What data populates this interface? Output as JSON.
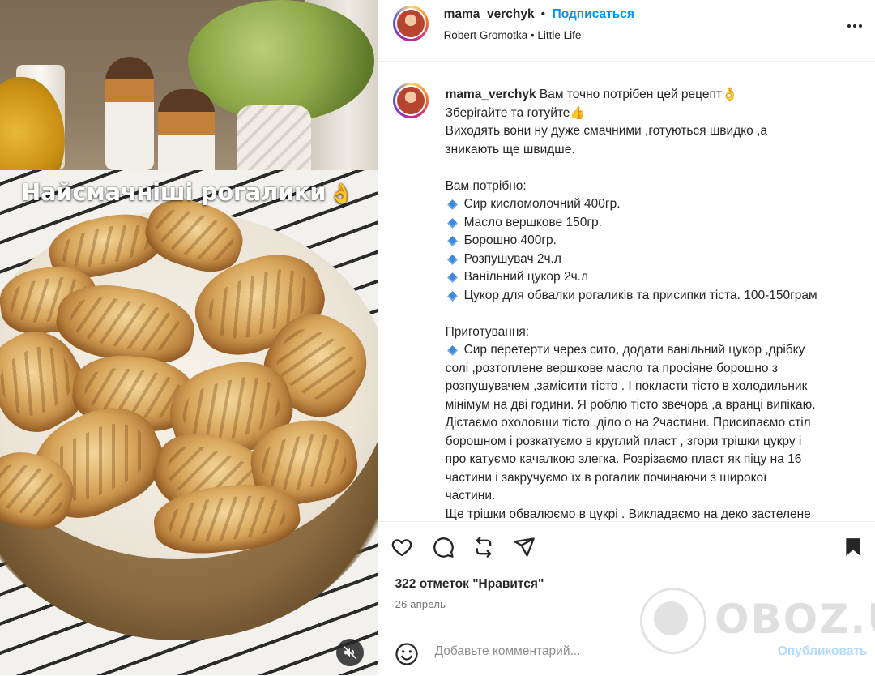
{
  "post": {
    "media": {
      "overlay_text": "Найсмачніші рогалики",
      "overlay_emoji": "👌",
      "mute_icon": "speaker-muted-icon"
    },
    "header": {
      "username": "mama_verchyk",
      "separator": "•",
      "follow_label": "Подписаться",
      "audio": "Robert Gromotka • Little Life",
      "more_icon": "more-horizontal-icon"
    },
    "caption": {
      "username": "mama_verchyk",
      "lines": [
        "Вам точно потрібен цей рецепт👌",
        "Зберігайте та готуйте👍",
        "Виходять вони ну дуже смачними ,готуються швидко ,а",
        "зникають ще швидше."
      ],
      "needs_title": "Вам потрібно:",
      "ingredients": [
        "Сир кисломолочний 400гр.",
        "Масло вершкове 150гр.",
        "Борошно 400гр.",
        "Розпушувач 2ч.л",
        "Ванільний цукор 2ч.л",
        "Цукор для обвалки рогаликів та присипки тіста. 100-150грам"
      ],
      "prep_title": "Приготування:",
      "prep_first": "Сир перетерти через сито, додати ванільний цукор ,дрібку",
      "prep_lines": [
        "солі ,розтоплене вершкове масло та просіяне борошно з",
        "розпушувачем ,замісити тісто . І покласти тісто в холодильник",
        "мінімум на дві години. Я роблю тісто звечора ,а вранці випікаю.",
        "Дістаємо охоловши тісто ,ділo о на 2частини. Присипаємо стіл",
        "борошном і розкатуємо в круглий пласт , згори трішки цукру і",
        "про катуємо качалкою злегка. Розрізаємо пласт як піцу на 16",
        "частини і закручуємо їх в рогалик починаючи з широкої",
        "частини.",
        "Ще трішки обвалюємо в цукрі . Викладаємо на деко застелене"
      ]
    },
    "actions": {
      "like_icon": "heart-icon",
      "comment_icon": "comment-icon",
      "repost_icon": "repost-icon",
      "share_icon": "share-icon",
      "save_icon": "bookmark-icon"
    },
    "likes_text": "322 отметок \"Нравится\"",
    "date_text": "26 апрель",
    "comment_box": {
      "emoji_icon": "emoji-icon",
      "placeholder": "Добавьте комментарий...",
      "publish_label": "Опубликовать"
    },
    "watermark_text": "OBOZ.UA",
    "colors": {
      "link_blue": "#0095f6",
      "publish_disabled": "#b3dbff",
      "text": "#262626",
      "secondary": "#737373"
    }
  }
}
